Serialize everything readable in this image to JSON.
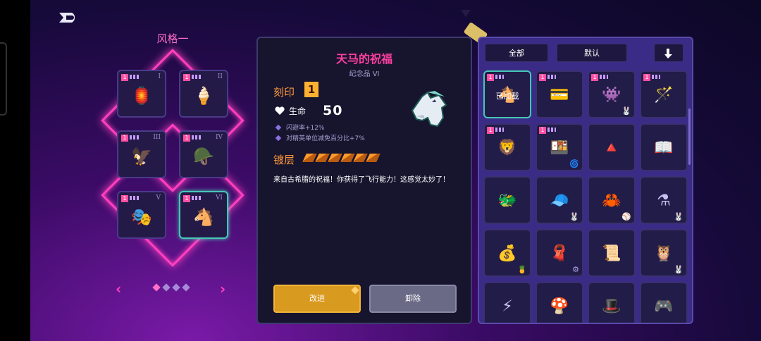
{
  "nav": {
    "back_icon": "back-arrow-icon"
  },
  "loadout": {
    "title": "风格一",
    "slots": [
      {
        "level": "1",
        "roman": "I",
        "icon": "lantern-icon",
        "glyph": "🏮"
      },
      {
        "level": "1",
        "roman": "II",
        "icon": "popsicle-icon",
        "glyph": "🍦"
      },
      {
        "level": "1",
        "roman": "III",
        "icon": "winged-emblem-icon",
        "glyph": "🦅"
      },
      {
        "level": "1",
        "roman": "IV",
        "icon": "visor-helmet-icon",
        "glyph": "🪖"
      },
      {
        "level": "1",
        "roman": "V",
        "icon": "mask-icon",
        "glyph": "🎭"
      },
      {
        "level": "1",
        "roman": "VI",
        "icon": "pegasus-icon",
        "glyph": "🐴"
      }
    ],
    "selected_index": 5,
    "pager": {
      "left": "‹",
      "right": "›",
      "pages": 4,
      "current": 0
    }
  },
  "detail": {
    "name": "天马的祝福",
    "subtitle": "纪念品 VI",
    "icon": "pegasus-icon",
    "imprint_label": "刻印",
    "imprint_value": "1",
    "hp_label": "生命",
    "hp_value": "50",
    "stats": [
      "闪避率+12%",
      "对精英单位减免百分比+7%"
    ],
    "plating_label": "镀层",
    "plating_count": 6,
    "description": "来自古希腊的祝福！你获得了飞行能力！这感觉太妙了！",
    "improve_label": "改进",
    "remove_label": "卸除"
  },
  "inventory": {
    "filter_all": "全部",
    "sort_default": "默认",
    "sort_icon": "sort-down-icon",
    "equipped_label": "已加载",
    "items": [
      {
        "icon": "pegasus-icon",
        "glyph": "🐴",
        "level": "1",
        "equipped": true,
        "sub": ""
      },
      {
        "icon": "green-card-icon",
        "glyph": "💳",
        "level": "1",
        "equipped": false,
        "sub": ""
      },
      {
        "icon": "bomb-creature-icon",
        "glyph": "👾",
        "level": "1",
        "equipped": false,
        "sub": "🐰"
      },
      {
        "icon": "magic-wand-icon",
        "glyph": "🪄",
        "level": "1",
        "equipped": false,
        "sub": ""
      },
      {
        "icon": "lion-shield-icon",
        "glyph": "🦁",
        "level": "1",
        "equipped": false,
        "sub": ""
      },
      {
        "icon": "red-tray-icon",
        "glyph": "🍱",
        "level": "1",
        "equipped": false,
        "sub": "🌀"
      },
      {
        "icon": "triangle-eye-icon",
        "glyph": "🔺",
        "level": "",
        "equipped": false,
        "sub": ""
      },
      {
        "icon": "book-icon",
        "glyph": "📖",
        "level": "",
        "equipped": false,
        "sub": ""
      },
      {
        "icon": "dragon-head-icon",
        "glyph": "🐲",
        "level": "",
        "equipped": false,
        "sub": ""
      },
      {
        "icon": "cap-icon",
        "glyph": "🧢",
        "level": "",
        "equipped": false,
        "sub": "🐰"
      },
      {
        "icon": "crab-icon",
        "glyph": "🦀",
        "level": "",
        "equipped": false,
        "sub": "⚾"
      },
      {
        "icon": "potion-icon",
        "glyph": "⚗",
        "level": "",
        "equipped": false,
        "sub": "🐰"
      },
      {
        "icon": "sack-icon",
        "glyph": "💰",
        "level": "",
        "equipped": false,
        "sub": "🍍"
      },
      {
        "icon": "scarf-icon",
        "glyph": "🧣",
        "level": "",
        "equipped": false,
        "sub": "⚙"
      },
      {
        "icon": "scroll-icon",
        "glyph": "📜",
        "level": "",
        "equipped": false,
        "sub": ""
      },
      {
        "icon": "owl-icon",
        "glyph": "🦉",
        "level": "",
        "equipped": false,
        "sub": "🐰"
      },
      {
        "icon": "lightning-icon",
        "glyph": "⚡",
        "level": "",
        "equipped": false,
        "sub": ""
      },
      {
        "icon": "mushroom-icon",
        "glyph": "🍄",
        "level": "",
        "equipped": false,
        "sub": ""
      },
      {
        "icon": "hat-icon",
        "glyph": "🎩",
        "level": "",
        "equipped": false,
        "sub": ""
      },
      {
        "icon": "controller-icon",
        "glyph": "🎮",
        "level": "",
        "equipped": false,
        "sub": ""
      }
    ]
  },
  "colors": {
    "accent_pink": "#ff3fbf",
    "selected_teal": "#45c8b4",
    "plating_orange": "#ff9a3a"
  }
}
